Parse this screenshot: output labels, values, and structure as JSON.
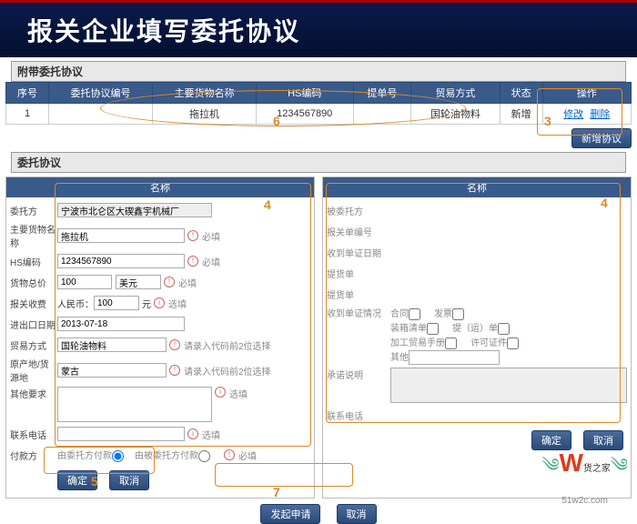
{
  "slide_title": "报关企业填写委托协议",
  "section1_title": "附带委托协议",
  "table": {
    "headers": [
      "序号",
      "委托协议编号",
      "主要货物名称",
      "HS编码",
      "提单号",
      "贸易方式",
      "状态",
      "操作"
    ],
    "row": {
      "idx": "1",
      "agreement_no": "",
      "goods": "拖拉机",
      "hs": "1234567890",
      "bill": "",
      "trade": "国轮油物料",
      "status": "新增",
      "op_edit": "修改",
      "op_del": "删除"
    }
  },
  "btn_new_agreement": "新增协议",
  "section2_title": "委托协议",
  "left": {
    "head": "名称",
    "entrustor_lbl": "委托方",
    "entrustor_val": "宁波市北仑区大碶鑫宇机械厂",
    "goods_lbl": "主要货物名称",
    "goods_val": "拖拉机",
    "hs_lbl": "HS编码",
    "hs_val": "1234567890",
    "total_lbl": "货物总价",
    "total_val": "100",
    "total_unit": "美元",
    "fee_lbl": "报关收费",
    "fee_prefix": "人民币：",
    "fee_val": "100",
    "fee_unit": "元",
    "date_lbl": "进出口日期",
    "date_val": "2013-07-18",
    "trade_lbl": "贸易方式",
    "trade_val": "国轮油物料",
    "trade_hint": "请录入代码前2位选择",
    "origin_lbl": "原产地/货源地",
    "origin_val": "蒙古",
    "origin_hint": "请录入代码前2位选择",
    "other_lbl": "其他要求",
    "phone_lbl": "联系电话",
    "pay_lbl": "付款方",
    "pay_opt1": "由委托方付款",
    "pay_opt2": "由被委托方付款",
    "req": "必填",
    "opt": "选填",
    "btn_ok": "确定",
    "btn_cancel": "取消"
  },
  "right": {
    "head": "名称",
    "entrustee_lbl": "被委托方",
    "bill_lbl": "报关单编号",
    "receipt_date_lbl": "收到单证日期",
    "bill_lading_lbl": "提货单",
    "hand_lbl": "提货单",
    "cert_lbl": "收到单证情况",
    "contract": "合同",
    "invoice": "发票",
    "packing": "装箱清单",
    "permit": "提（运）单",
    "manual": "加工贸易手册",
    "license": "许可证件",
    "other": "其他",
    "note_lbl": "承诺说明",
    "phone_lbl": "联系电话",
    "btn_ok": "确定",
    "btn_cancel": "取消"
  },
  "footer": {
    "btn_send": "发起申请",
    "btn_cancel": "取消"
  },
  "annotations": {
    "n3": "3",
    "n4": "4",
    "n5": "5",
    "n6": "6",
    "n7": "7"
  },
  "watermark": {
    "brand": "货之家",
    "url": "51w2c.com"
  }
}
